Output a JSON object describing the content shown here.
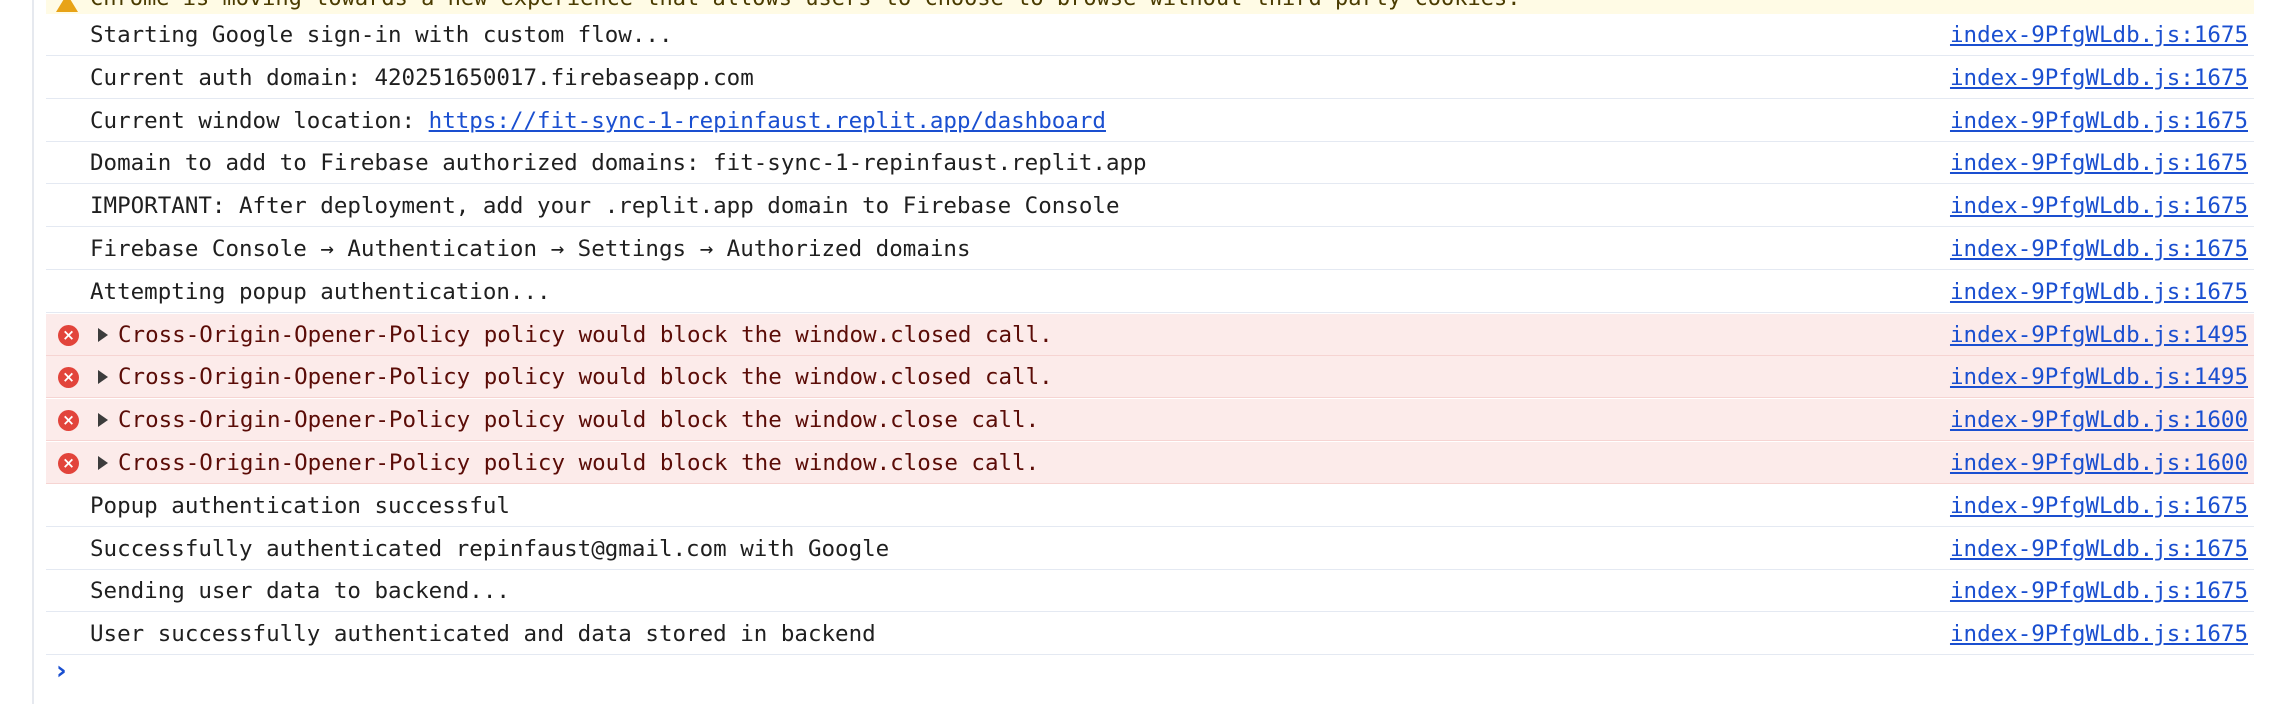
{
  "warning": {
    "text": "Chrome is moving towards a new experience that allows users to choose to browse without third-party cookies."
  },
  "messages": [
    {
      "level": "log",
      "text": "Starting Google sign-in with custom flow...",
      "source": "index-9PfgWLdb.js:1675"
    },
    {
      "level": "log",
      "text": "Current auth domain: 420251650017.firebaseapp.com",
      "source": "index-9PfgWLdb.js:1675"
    },
    {
      "level": "log",
      "prefix": "Current window location: ",
      "link": "https://fit-sync-1-repinfaust.replit.app/dashboard",
      "source": "index-9PfgWLdb.js:1675"
    },
    {
      "level": "log",
      "text": "Domain to add to Firebase authorized domains: fit-sync-1-repinfaust.replit.app",
      "source": "index-9PfgWLdb.js:1675"
    },
    {
      "level": "log",
      "text": "IMPORTANT: After deployment, add your .replit.app domain to Firebase Console",
      "source": "index-9PfgWLdb.js:1675"
    },
    {
      "level": "log",
      "text": "Firebase Console → Authentication → Settings → Authorized domains",
      "source": "index-9PfgWLdb.js:1675"
    },
    {
      "level": "log",
      "text": "Attempting popup authentication...",
      "source": "index-9PfgWLdb.js:1675"
    },
    {
      "level": "error",
      "text": "Cross-Origin-Opener-Policy policy would block the window.closed call.",
      "source": "index-9PfgWLdb.js:1495"
    },
    {
      "level": "error",
      "text": "Cross-Origin-Opener-Policy policy would block the window.closed call.",
      "source": "index-9PfgWLdb.js:1495"
    },
    {
      "level": "error",
      "text": "Cross-Origin-Opener-Policy policy would block the window.close call.",
      "source": "index-9PfgWLdb.js:1600"
    },
    {
      "level": "error",
      "text": "Cross-Origin-Opener-Policy policy would block the window.close call.",
      "source": "index-9PfgWLdb.js:1600"
    },
    {
      "level": "log",
      "text": "Popup authentication successful",
      "source": "index-9PfgWLdb.js:1675"
    },
    {
      "level": "log",
      "text": "Successfully authenticated repinfaust@gmail.com with Google",
      "source": "index-9PfgWLdb.js:1675"
    },
    {
      "level": "log",
      "text": "Sending user data to backend...",
      "source": "index-9PfgWLdb.js:1675"
    },
    {
      "level": "log",
      "text": "User successfully authenticated and data stored in backend",
      "source": "index-9PfgWLdb.js:1675"
    }
  ],
  "prompt": {
    "symbol": "›"
  },
  "colors": {
    "link": "#1a4fd0",
    "error_bg": "#fcebea",
    "error_icon": "#e2443b",
    "warning_bg": "#fffbe5",
    "warning_icon": "#e8a317"
  },
  "icons": {
    "error": "error-circle-icon",
    "expand": "expand-triangle-icon",
    "warning": "warning-triangle-icon",
    "close": "close-circle-icon",
    "prompt": "chevron-right-icon"
  }
}
